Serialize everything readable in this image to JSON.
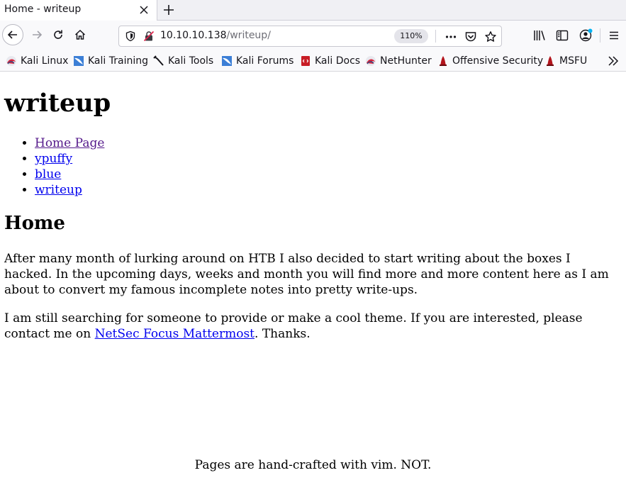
{
  "tab": {
    "title": "Home - writeup"
  },
  "address_bar": {
    "host": "10.10.10.138",
    "path": "/writeup/",
    "zoom": "110%"
  },
  "bookmarks": [
    {
      "label": "Kali Linux",
      "icon": "kali-dragon-icon"
    },
    {
      "label": "Kali Training",
      "icon": "kali-training-icon"
    },
    {
      "label": "Kali Tools",
      "icon": "kali-tools-icon"
    },
    {
      "label": "Kali Forums",
      "icon": "kali-forums-icon"
    },
    {
      "label": "Kali Docs",
      "icon": "kali-docs-icon"
    },
    {
      "label": "NetHunter",
      "icon": "nethunter-icon"
    },
    {
      "label": "Offensive Security",
      "icon": "offsec-icon"
    },
    {
      "label": "MSFU",
      "icon": "msfu-icon"
    }
  ],
  "page": {
    "site_title": "writeup",
    "nav": [
      {
        "label": "Home Page",
        "visited": true
      },
      {
        "label": "ypuffy",
        "visited": false
      },
      {
        "label": "blue",
        "visited": false
      },
      {
        "label": "writeup",
        "visited": false
      }
    ],
    "section_title": "Home",
    "paragraph_1": "After many month of lurking around on HTB I also decided to start writing about the boxes I hacked. In the upcoming days, weeks and month you will find more and more content here as I am about to convert my famous incomplete notes into pretty write-ups.",
    "paragraph_2_before": "I am still searching for someone to provide or make a cool theme. If you are interested, please contact me on ",
    "paragraph_2_link": "NetSec Focus Mattermost",
    "paragraph_2_after": ". Thanks.",
    "footer": "Pages are hand-crafted with vim. NOT."
  },
  "colors": {
    "link": "#0000ee",
    "visited_link": "#551a8b",
    "toolbar_bg": "#f9f9fb",
    "tabstrip_bg": "#f0f0f4",
    "account_dot": "#00b3f4"
  }
}
